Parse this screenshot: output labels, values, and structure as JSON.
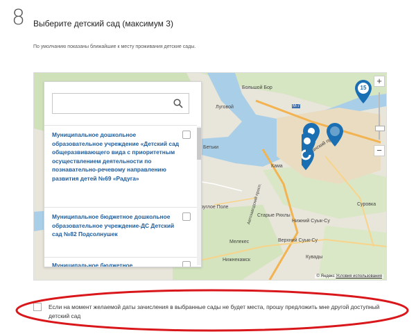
{
  "step": {
    "number": "8",
    "title": "Выберите детский сад (максимум 3)",
    "hint": "По умолчанию показаны ближайшие к месту проживания детские сады."
  },
  "search": {
    "placeholder": "",
    "value": ""
  },
  "kindergartens": [
    {
      "name": "Муниципальное дошкольное образовательное учреждение «Детский сад общеразвивающего вида с приоритетным осуществлением деятельности по познавательно-речевому направлению развития детей №69 «Радуга»",
      "checked": false
    },
    {
      "name": "Муниципальное бюджетное дошкольное образовательное учреждение-ДС Детский сад №82 Подсолнушек",
      "checked": false
    },
    {
      "name": "Муниципальное бюджетное",
      "checked": false
    }
  ],
  "map": {
    "labels": {
      "bolshoy_bor": "Большой Бор",
      "luchevoy": "Луговой",
      "betki": "Бетьки",
      "kama": "Кама",
      "kruglove_pole": "Круглое Поле",
      "sryye_ryukly": "Старые Ряхлы",
      "meleks": "Мелекес",
      "nizhny_suk_su": "Нижний Суык-Су",
      "verkhny_suk_su": "Верхний Суык-Су",
      "surovka": "Суровка",
      "kuvady": "Кувады",
      "nizhnekamsk": "Нижнекамск",
      "kazansky_prospekt": "Казанский просп.",
      "m7": "М-7",
      "avtozavodsky": "Автозаводский просп."
    },
    "marker_badge": "15",
    "zoom_in": "+",
    "zoom_out": "−",
    "copyright": "© Яндекс",
    "terms_link": "Условия использования"
  },
  "consent": {
    "checked": false,
    "text": "Если на момент желаемой даты зачисления в выбранные сады не будет места, прошу предложить мне другой доступный детский сад"
  },
  "colors": {
    "marker": "#1a6fb3",
    "link": "#1e5c9c",
    "annotation": "#d9171b"
  }
}
